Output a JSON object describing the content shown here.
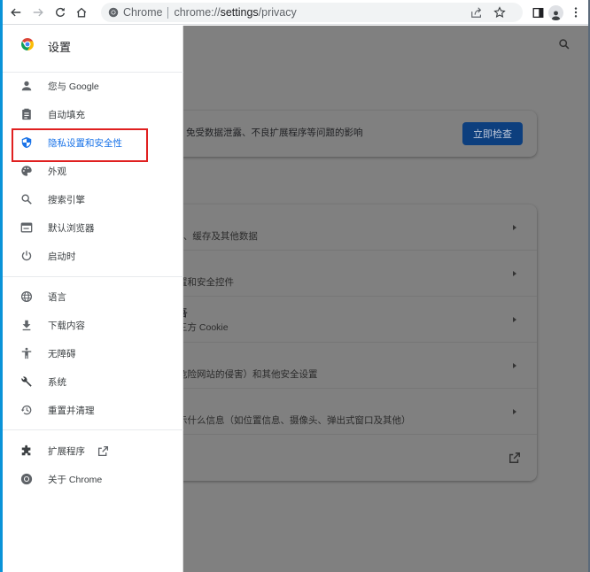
{
  "browser": {
    "omnibox": {
      "chip": "Chrome",
      "url_scheme": "chrome://",
      "url_host": "settings",
      "url_path": "/privacy"
    },
    "icons": [
      "back-icon",
      "forward-icon",
      "reload-icon",
      "home-icon",
      "share-icon",
      "bookmark-star-icon",
      "side-panel-icon",
      "profile-icon",
      "menu-icon"
    ]
  },
  "drawer": {
    "title": "设置",
    "items": [
      {
        "label": "您与 Google",
        "icon": "person-icon"
      },
      {
        "label": "自动填充",
        "icon": "clipboard-icon"
      },
      {
        "label": "隐私设置和安全性",
        "icon": "shield-icon",
        "active": true
      },
      {
        "label": "外观",
        "icon": "palette-icon"
      },
      {
        "label": "搜索引擎",
        "icon": "search-icon"
      },
      {
        "label": "默认浏览器",
        "icon": "browser-icon"
      },
      {
        "label": "启动时",
        "icon": "power-icon"
      },
      {
        "label": "语言",
        "icon": "globe-icon"
      },
      {
        "label": "下载内容",
        "icon": "download-icon"
      },
      {
        "label": "无障碍",
        "icon": "accessibility-icon"
      },
      {
        "label": "系统",
        "icon": "wrench-icon"
      },
      {
        "label": "重置并清理",
        "icon": "history-icon"
      },
      {
        "label": "扩展程序",
        "icon": "puzzle-icon"
      },
      {
        "label": "关于 Chrome",
        "icon": "chrome-icon"
      }
    ]
  },
  "main": {
    "safety_check": {
      "text": "免受数据泄露、不良扩展程序等问题的影响",
      "button": "立即检查"
    },
    "rows": [
      {
        "title": "",
        "sub": "e、缓存及其他数据"
      },
      {
        "title": "",
        "sub": "置和安全控件"
      },
      {
        "title": "吾",
        "sub": "三方 Cookie"
      },
      {
        "title": "",
        "sub": "危险网站的侵害）和其他安全设置"
      },
      {
        "title": "",
        "sub": "示什么信息（如位置信息、摄像头、弹出式窗口及其他）"
      },
      {
        "title": "",
        "sub": ""
      }
    ]
  },
  "colors": {
    "accent": "#1a73e8",
    "highlight_box": "#e02020",
    "scrim": "#808080",
    "check_button": "#0d3f7e"
  }
}
